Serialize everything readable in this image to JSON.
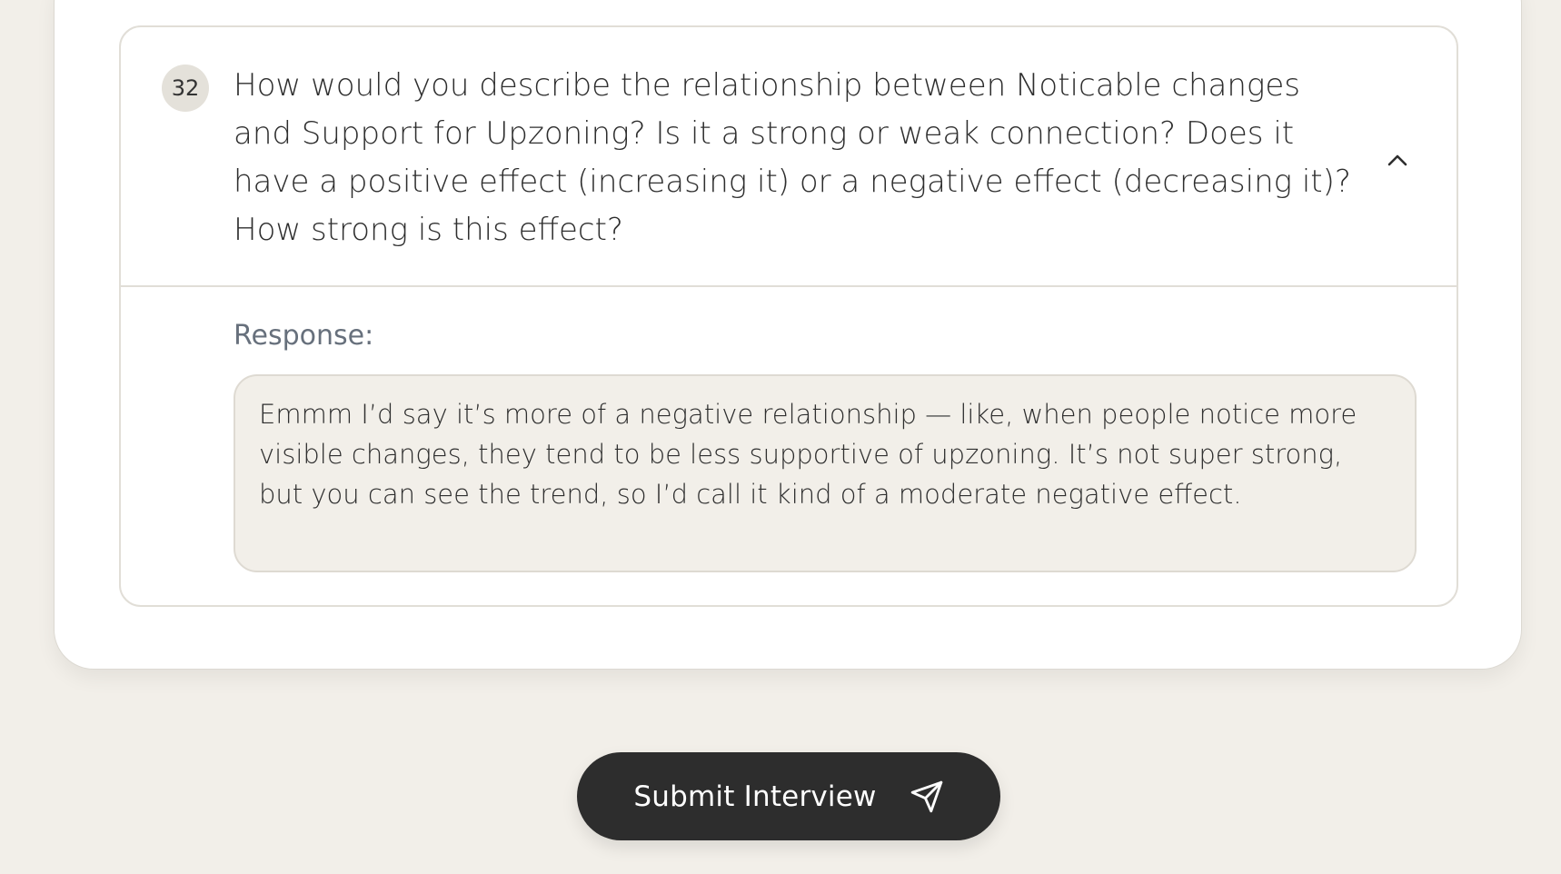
{
  "question": {
    "number": "32",
    "text": "How would you describe the relationship between Noticable changes and Support for Upzoning? Is it a strong or weak connection? Does it have a positive effect (increasing it) or a negative effect (decreasing it)? How strong is this effect?",
    "toggle_icon": "chevron-up-icon",
    "expanded": true
  },
  "response": {
    "label": "Response:",
    "value": "Emmm I’d say it’s more of a negative relationship — like, when people notice more visible changes, they tend to be less supportive of upzoning. It’s not super strong, but you can see the trend, so I’d call it kind of a moderate negative effect."
  },
  "submit": {
    "label": "Submit Interview",
    "icon": "send-icon"
  },
  "colors": {
    "page_background": "#f2efe9",
    "card_background": "#ffffff",
    "button_background": "#2d2d2d",
    "label_color": "#67707c"
  }
}
